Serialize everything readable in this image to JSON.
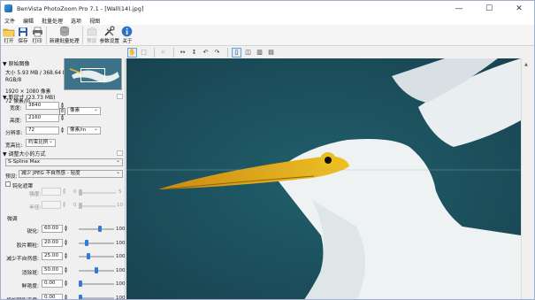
{
  "window": {
    "title": "BenVista PhotoZoom Pro 7.1 - [Wall(14).jpg]",
    "buttons": {
      "minimize": "—",
      "maximize": "☐",
      "close": "✕"
    }
  },
  "menu": [
    "文件",
    "编辑",
    "批量处理",
    "选项",
    "视图"
  ],
  "toolbar": {
    "open": "打开",
    "save": "保存",
    "print": "打印",
    "batch": "新建批量处理",
    "preset": "预设",
    "settings": "参数设置",
    "about": "关于"
  },
  "original": {
    "header": "原始图像",
    "size": "大小 5.93 MB / 368.64 KB",
    "color": "RGB/8",
    "dims": "1920 × 1080 像素",
    "res": "72 像素/in"
  },
  "new_size": {
    "header": "新尺寸 (23.73 MB)",
    "width_label": "宽度:",
    "width": "3840",
    "height_label": "高度:",
    "height": "2160",
    "res_label": "分辨率:",
    "res": "72",
    "unit": "像素",
    "res_unit": "像素/in",
    "aspect_label": "宽高比:",
    "aspect": "约束比例"
  },
  "resize": {
    "header": "调整大小的方式",
    "method": "S-Spline Max",
    "preset_label": "预设:",
    "preset": "减少 JPEG 不自然感 - 轻度"
  },
  "sharpen": {
    "unsharp_label": "钝化遮罩",
    "strength_label": "强度:",
    "strength_min": "0",
    "strength_max": "5",
    "radius_label": "半径:",
    "radius_min": "0",
    "radius_max": "10"
  },
  "finetune": {
    "header": "微调",
    "rows": [
      {
        "label": "锐化:",
        "value": "60.00",
        "max": "100",
        "level": 0.6
      },
      {
        "label": "胶片颗粒:",
        "value": "20.00",
        "max": "100",
        "level": 0.2
      },
      {
        "label": "减少不自然感:",
        "value": "25.00",
        "max": "100",
        "level": 0.25
      },
      {
        "label": "消除斑:",
        "value": "50.00",
        "max": "100",
        "level": 0.5
      },
      {
        "label": "鲜艳度:",
        "value": "0.00",
        "max": "100",
        "level": 0.0
      },
      {
        "label": "增加阴影亮度:",
        "value": "0.00",
        "max": "100",
        "level": 0.0
      }
    ]
  }
}
